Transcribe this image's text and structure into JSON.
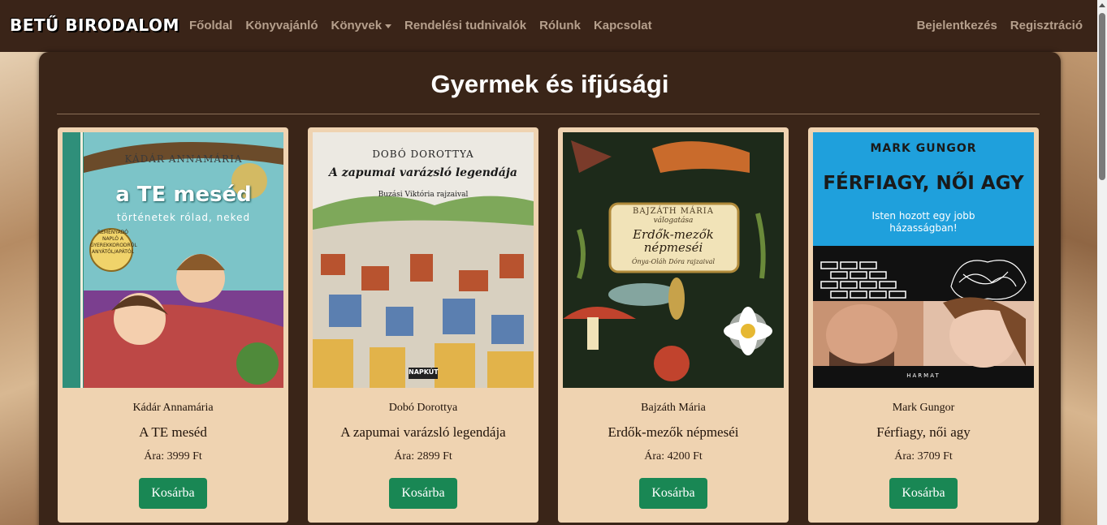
{
  "navbar": {
    "brand": "BETŰ BIRODALOM",
    "links": [
      "Főoldal",
      "Könyvajánló",
      "Könyvek",
      "Rendelési tudnivalók",
      "Rólunk",
      "Kapcsolat"
    ],
    "right_links": [
      "Bejelentkezés",
      "Regisztráció"
    ]
  },
  "page": {
    "title": "Gyermek és ifjúsági"
  },
  "books": [
    {
      "author": "Kádár Annamária",
      "title": "A TE meséd",
      "price": "Ára: 3999 Ft",
      "button": "Kosárba",
      "cover": {
        "author": "KÁDÁR ANNAMÁRIA",
        "title": "a TE meséd",
        "subtitle": "történetek rólad, neked",
        "badge": "REMÉNYADÓ NAPLÓ A GYEREKKORODRÓL ANYÁTÓL/APÁTÓL",
        "colors": [
          "#2f8f7a",
          "#f0d36a",
          "#c94a3a"
        ]
      }
    },
    {
      "author": "Dobó Dorottya",
      "title": "A zapumai varázsló legendája",
      "price": "Ára: 2899 Ft",
      "button": "Kosárba",
      "cover": {
        "author": "DOBÓ DOROTTYA",
        "title": "A zapumai varázsló legendája",
        "subtitle": "Buzási Viktória rajzaival",
        "publisher": "NAPKÚT",
        "colors": [
          "#e9e6df",
          "#6c9a4a",
          "#b8532f"
        ]
      }
    },
    {
      "author": "Bajzáth Mária",
      "title": "Erdők-mezők népmeséi",
      "price": "Ára: 4200 Ft",
      "button": "Kosárba",
      "cover": {
        "author": "BAJZÁTH MÁRIA",
        "editor": "válogatása",
        "title": "Erdők-mezők népmeséi",
        "illustrator": "Ónya-Oláh Dóra rajzaival",
        "colors": [
          "#1d2a1a",
          "#f1e3b8",
          "#c1432d"
        ]
      }
    },
    {
      "author": "Mark Gungor",
      "title": "Férfiagy, női agy",
      "price": "Ára: 3709 Ft",
      "button": "Kosárba",
      "cover": {
        "author": "MARK GUNGOR",
        "title": "FÉRFIAGY, NŐI AGY",
        "subtitle": "Isten hozott egy jobb házasságban!",
        "publisher": "HARMAT",
        "colors": [
          "#1fa0dc",
          "#111111",
          "#d7a98a"
        ]
      }
    }
  ]
}
